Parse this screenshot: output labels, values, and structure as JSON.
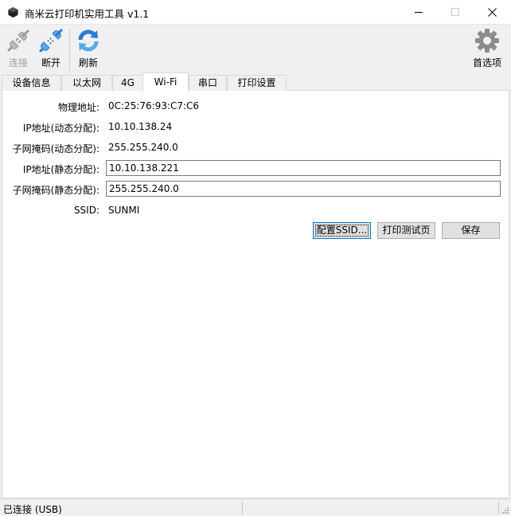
{
  "window": {
    "title": "商米云打印机实用工具 v1.1",
    "icon": "black-cube-icon"
  },
  "toolbar": {
    "connect_label": "连接",
    "disconnect_label": "断开",
    "refresh_label": "刷新",
    "preferences_label": "首选项"
  },
  "tabs": [
    {
      "label": "设备信息",
      "active": false
    },
    {
      "label": "以太网",
      "active": false
    },
    {
      "label": "4G",
      "active": false
    },
    {
      "label": "Wi-Fi",
      "active": true
    },
    {
      "label": "串口",
      "active": false
    },
    {
      "label": "打印设置",
      "active": false
    }
  ],
  "wifi": {
    "mac_label": "物理地址:",
    "mac_value": "0C:25:76:93:C7:C6",
    "dyn_ip_label": "IP地址(动态分配):",
    "dyn_ip_value": "10.10.138.24",
    "dyn_mask_label": "子网掩码(动态分配):",
    "dyn_mask_value": "255.255.240.0",
    "static_ip_label": "IP地址(静态分配):",
    "static_ip_value": "10.10.138.221",
    "static_mask_label": "子网掩码(静态分配):",
    "static_mask_value": "255.255.240.0",
    "ssid_label": "SSID:",
    "ssid_value": "SUNMI",
    "config_ssid_button": "配置SSID...",
    "print_test_button": "打印测试页",
    "save_button": "保存"
  },
  "status": {
    "connection": "已连接 (USB)"
  },
  "colors": {
    "accent_blue": "#2b7bd6",
    "focus_border": "#0078d7"
  }
}
